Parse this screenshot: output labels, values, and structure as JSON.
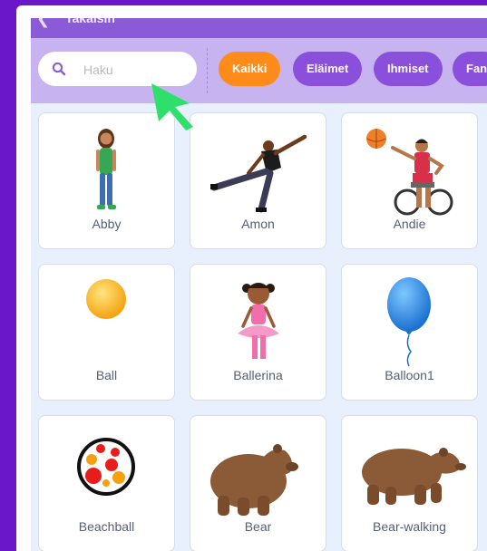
{
  "header": {
    "back_label": "Takaisin"
  },
  "search": {
    "placeholder": "Haku",
    "value": ""
  },
  "filters": [
    {
      "label": "Kaikki",
      "active": true
    },
    {
      "label": "Eläimet",
      "active": false
    },
    {
      "label": "Ihmiset",
      "active": false
    },
    {
      "label": "Fan",
      "active": false
    }
  ],
  "sprites": [
    {
      "name": "Abby"
    },
    {
      "name": "Amon"
    },
    {
      "name": "Andie"
    },
    {
      "name": "Ball"
    },
    {
      "name": "Ballerina"
    },
    {
      "name": "Balloon1"
    },
    {
      "name": "Beachball"
    },
    {
      "name": "Bear"
    },
    {
      "name": "Bear-walking"
    }
  ],
  "colors": {
    "page_bg": "#6a16c9",
    "filterbar_bg": "#c6b3ef",
    "tag_bg": "#8a4fdb",
    "tag_active_bg": "#ff8c1a",
    "grid_bg": "#e7f0fc",
    "cursor": "#2edf6b"
  }
}
